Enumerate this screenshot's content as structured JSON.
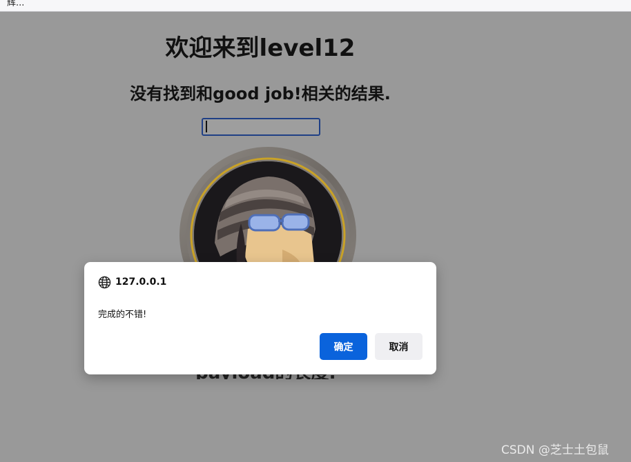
{
  "browser": {
    "top_text": "辉..."
  },
  "page": {
    "title": "欢迎来到level12",
    "result_text": "没有找到和good job!相关的结果.",
    "search_value": "",
    "bottom_caption": "payload的长度:"
  },
  "dialog": {
    "icon": "globe-icon",
    "origin": "127.0.0.1",
    "message": "完成的不错!",
    "ok_label": "确定",
    "cancel_label": "取消"
  },
  "watermark": "CSDN @芝士土包鼠",
  "colors": {
    "overlay_gray": "#999999",
    "ok_button": "#0a63dc",
    "cancel_button": "#efeff2",
    "input_border": "#1f3f85",
    "avatar_ring_gold": "#c9a227"
  }
}
